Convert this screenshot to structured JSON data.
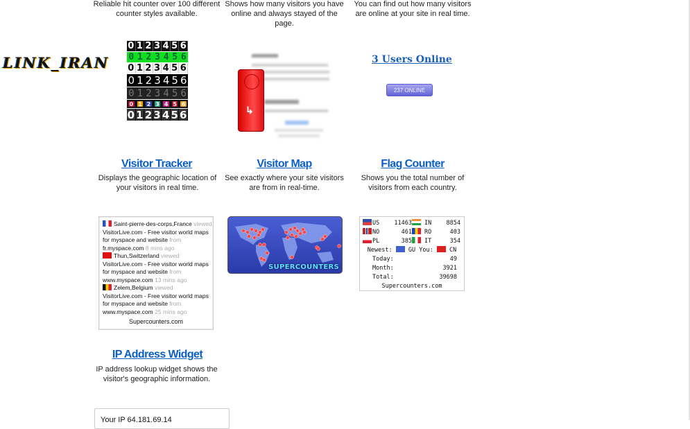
{
  "top_row": {
    "hit_counter_desc": "Reliable hit counter over 100 different counter styles available.",
    "floating_desc": "Shows how many visitors you have online and always stayed of the page.",
    "users_online_desc": "You can find out how many visitors are online at your site in real time."
  },
  "logo": {
    "text": "LINK_IRAN"
  },
  "counter_digits": [
    "0",
    "1",
    "2",
    "3",
    "4",
    "5",
    "6"
  ],
  "users_online": {
    "link_text": "3 Users Online",
    "badge_text": "237 ONLINE"
  },
  "widgets": [
    {
      "title": "Visitor Tracker",
      "desc": "Displays the geographic location of your visitors in real time."
    },
    {
      "title": "Visitor Map",
      "desc": "See exactly where your site visitors are from in real-time."
    },
    {
      "title": "Flag Counter",
      "desc": "Shows you the total number of visitors from each country."
    },
    {
      "title": "IP Address Widget",
      "desc": "IP address lookup widget shows the visitor's geographic information."
    }
  ],
  "tracker": {
    "entries": [
      {
        "location": "Saint-pierre-des-corps,France",
        "viewed": "viewed",
        "site": "VisitorLive.com - Free visitor world maps for myspace and website",
        "from": "from",
        "referrer": "fr.myspace.com",
        "time": "8 mins ago",
        "flag": "france"
      },
      {
        "location": "Thun,Switzerland",
        "viewed": "viewed",
        "site": "VisitorLive.com - Free visitor world maps for myspace and website",
        "from": "from",
        "referrer": "www.myspace.com",
        "time": "13 mins ago",
        "flag": "switzerland"
      },
      {
        "location": "Zelem,Belgium",
        "viewed": "viewed",
        "site": "VisitorLive.com - Free visitor world maps for myspace and website",
        "from": "from",
        "referrer": "www.myspace.com",
        "time": "25 mins ago",
        "flag": "belgium"
      }
    ],
    "footer": "Supercounters.com"
  },
  "map": {
    "brand": "SUPERCOUNTERS"
  },
  "flag_counter": {
    "rows": [
      {
        "c1": "US",
        "v1": "11463",
        "c2": "IN",
        "v2": "8854"
      },
      {
        "c1": "NO",
        "v1": "461",
        "c2": "RO",
        "v2": "403"
      },
      {
        "c1": "PL",
        "v1": "385",
        "c2": "IT",
        "v2": "354"
      }
    ],
    "newest_label": "Newest:",
    "newest": "GU",
    "you_label": "You:",
    "you": "CN",
    "today_label": "Today:",
    "today": "49",
    "month_label": "Month:",
    "month": "3921",
    "total_label": "Total:",
    "total": "39698",
    "footer": "Supercounters.com"
  },
  "ip_widget": {
    "partial_text": "Your IP 64.181.69.14"
  }
}
